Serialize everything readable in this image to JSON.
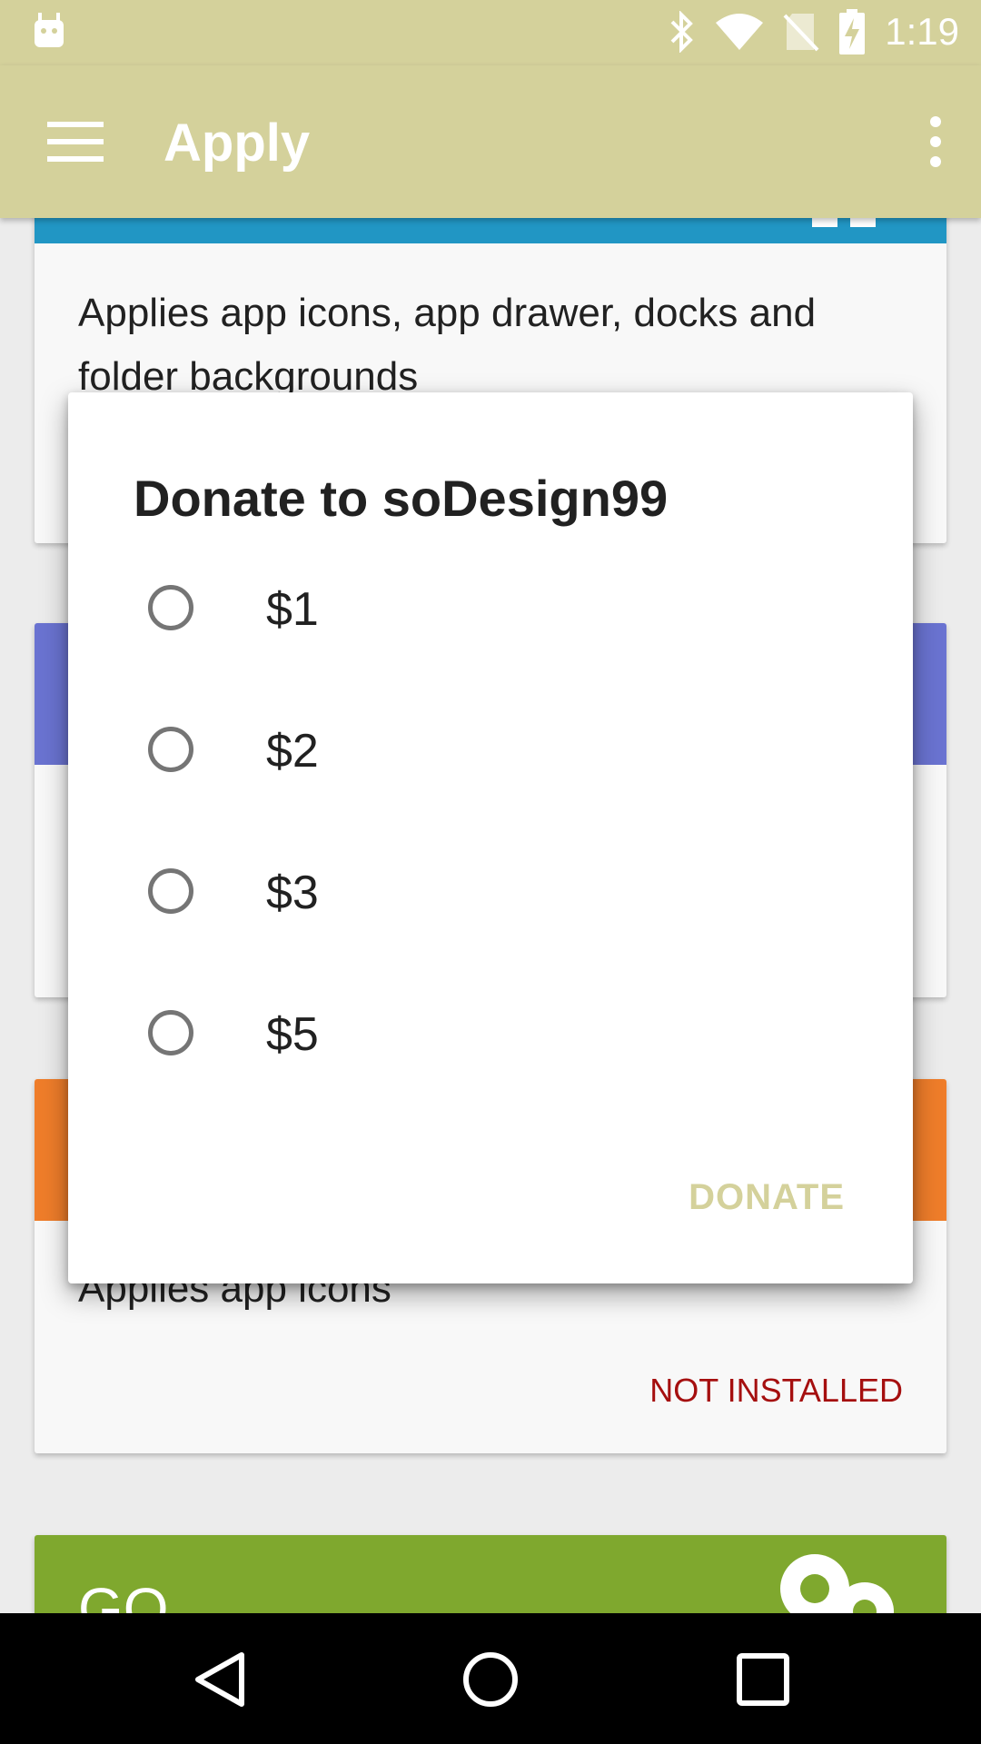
{
  "status_bar": {
    "time": "1:19",
    "icons": [
      "android-icon",
      "bluetooth-icon",
      "wifi-icon",
      "no-sim-icon",
      "battery-charging-icon"
    ]
  },
  "app_bar": {
    "title": "Apply",
    "color": "#d4d19b"
  },
  "cards": [
    {
      "header_color": "#2196c4",
      "description": "Applies app icons, app drawer, docks and folder backgrounds"
    },
    {
      "header_color": "#6a73d1"
    },
    {
      "header_color": "#ef7d2a",
      "description": "Applies app icons",
      "status": "NOT INSTALLED"
    },
    {
      "header_color": "#7fa82e",
      "header_text": "GO"
    }
  ],
  "dialog": {
    "title": "Donate to soDesign99",
    "options": [
      "$1",
      "$2",
      "$3",
      "$5"
    ],
    "action": "DONATE"
  }
}
